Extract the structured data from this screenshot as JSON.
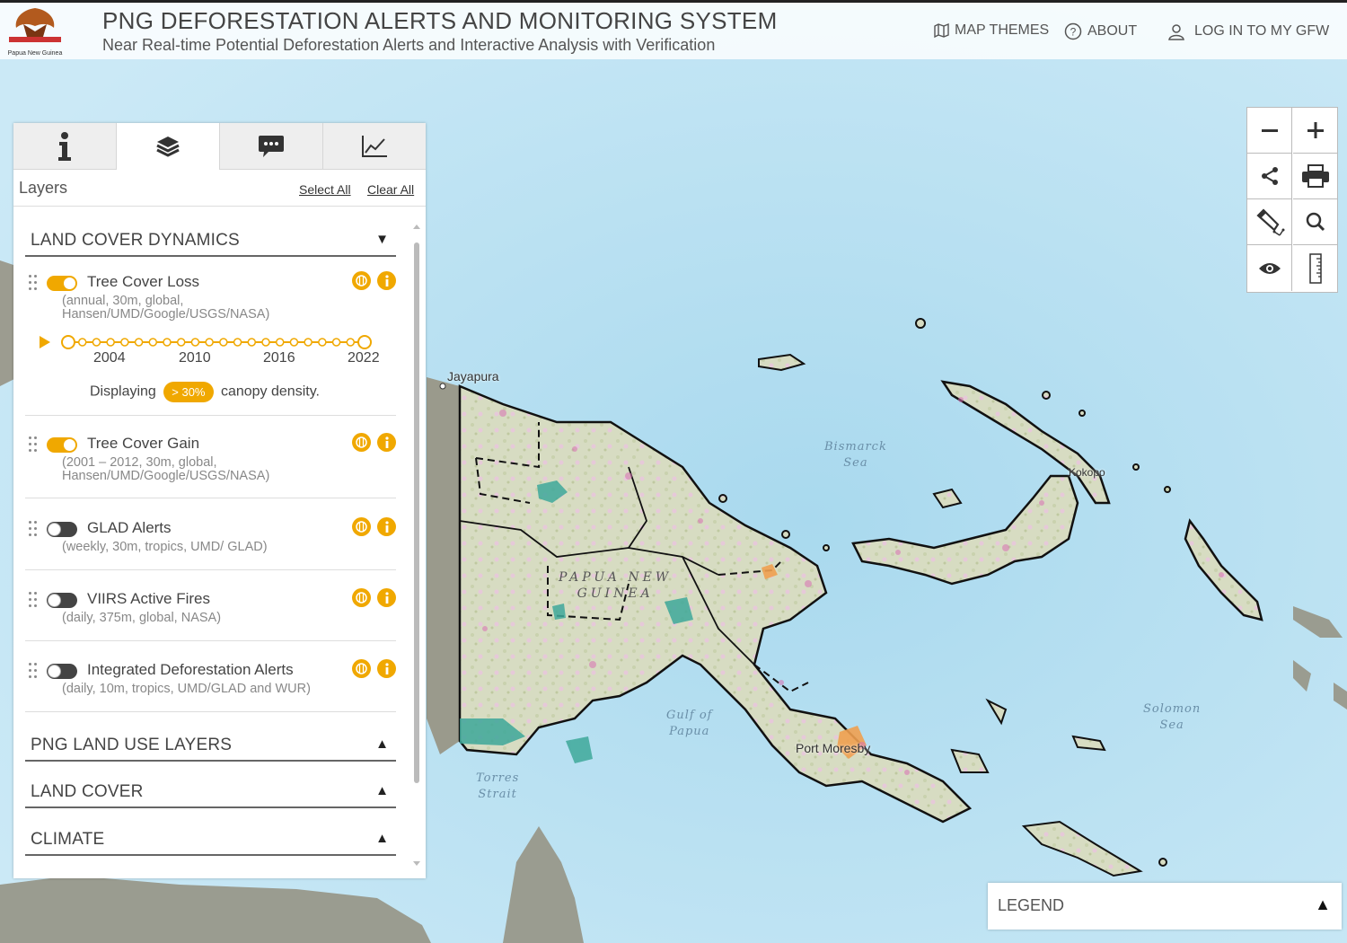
{
  "header": {
    "title": "PNG DEFORESTATION ALERTS AND MONITORING SYSTEM",
    "subtitle": "Near Real-time Potential Deforestation Alerts and Interactive Analysis with Verification",
    "nav": {
      "map_themes": "MAP THEMES",
      "about": "ABOUT",
      "login": "LOG IN TO MY GFW"
    },
    "logo_text": "Papua New Guinea"
  },
  "panel": {
    "tabs": [
      {
        "icon": "info-icon",
        "active": false
      },
      {
        "icon": "layers-icon",
        "active": true
      },
      {
        "icon": "comment-icon",
        "active": false
      },
      {
        "icon": "chart-icon",
        "active": false
      }
    ],
    "layers_title": "Layers",
    "select_all": "Select All",
    "clear_all": "Clear All",
    "sections": {
      "land_cover_dynamics": "LAND COVER DYNAMICS",
      "png_land_use": "PNG LAND USE LAYERS",
      "land_cover": "LAND COVER",
      "climate": "CLIMATE"
    },
    "items": [
      {
        "name": "Tree Cover Loss",
        "desc1": "(annual, 30m, global,",
        "desc2": "Hansen/UMD/Google/USGS/NASA)",
        "on": true
      },
      {
        "name": "Tree Cover Gain",
        "desc1": "(2001 – 2012, 30m, global,",
        "desc2": "Hansen/UMD/Google/USGS/NASA)",
        "on": true
      },
      {
        "name": "GLAD Alerts",
        "desc1": "(weekly, 30m, tropics, UMD/ GLAD)",
        "desc2": "",
        "on": false
      },
      {
        "name": "VIIRS Active Fires",
        "desc1": "(daily, 375m, global, NASA)",
        "desc2": "",
        "on": false
      },
      {
        "name": "Integrated Deforestation Alerts",
        "desc1": "(daily, 10m, tropics, UMD/GLAD and WUR)",
        "desc2": "",
        "on": false
      }
    ],
    "timeline": {
      "years": [
        "2004",
        "2010",
        "2016",
        "2022"
      ],
      "start_year": 2001,
      "end_year": 2022
    },
    "canopy": {
      "prefix": "Displaying",
      "badge": "> 30%",
      "suffix": "canopy density."
    }
  },
  "map": {
    "labels": {
      "jayapura": "Jayapura",
      "bismarck": "Bismarck",
      "bismarck2": "Sea",
      "country1": "PAPUA NEW",
      "country2": "GUINEA",
      "gulf1": "Gulf of",
      "gulf2": "Papua",
      "port_moresby": "Port Moresby",
      "solomon1": "Solomon",
      "solomon2": "Sea",
      "torres1": "Torres",
      "torres2": "Strait",
      "rabaul": "Kokopo"
    },
    "controls": [
      "zoom-out-icon",
      "zoom-in-icon",
      "share-icon",
      "print-icon",
      "draw-icon",
      "search-icon",
      "eye-icon",
      "ruler-icon"
    ]
  },
  "legend": {
    "label": "LEGEND"
  },
  "colors": {
    "accent": "#f0a800",
    "ocean": "#bfe3f2",
    "land": "#d9ddc4",
    "loss": "#d96fb4",
    "gain": "#3ea89a"
  }
}
